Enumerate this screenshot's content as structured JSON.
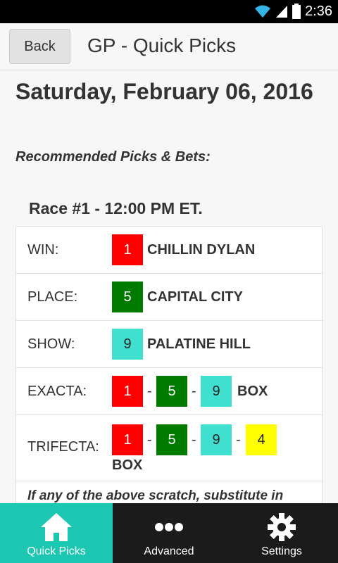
{
  "status": {
    "time": "2:36"
  },
  "header": {
    "back_label": "Back",
    "title": "GP - Quick Picks"
  },
  "content": {
    "date": "Saturday, February 06, 2016",
    "recommended_label": "Recommended Picks & Bets:",
    "race_title": "Race #1 - 12:00 PM ET.",
    "picks": {
      "win": {
        "label": "WIN:",
        "number": "1",
        "horse": "CHILLIN DYLAN"
      },
      "place": {
        "label": "PLACE:",
        "number": "5",
        "horse": "CAPITAL CITY"
      },
      "show": {
        "label": "SHOW:",
        "number": "9",
        "horse": "PALATINE HILL"
      },
      "exacta": {
        "label": "EXACTA:",
        "numbers": [
          "1",
          "5",
          "9"
        ],
        "box": "BOX"
      },
      "trifecta": {
        "label": "TRIFECTA:",
        "numbers": [
          "1",
          "5",
          "9",
          "4"
        ],
        "box": "BOX"
      }
    },
    "scratch_note": "If any of the above scratch, substitute in"
  },
  "tabs": [
    {
      "label": "Quick Picks",
      "icon": "home-icon"
    },
    {
      "label": "Advanced",
      "icon": "more-icon"
    },
    {
      "label": "Settings",
      "icon": "gear-icon"
    }
  ],
  "colors": {
    "red": "#ff0000",
    "green": "#007b00",
    "cyan": "#40e0d0",
    "yellow": "#ffff00",
    "active_tab": "#1cc7b2"
  }
}
